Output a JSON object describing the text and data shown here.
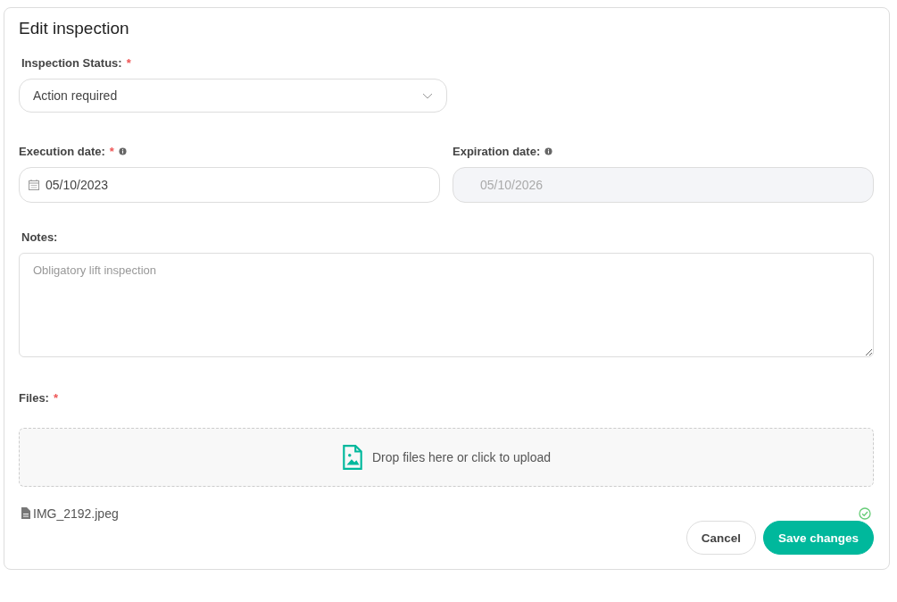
{
  "title": "Edit inspection",
  "status": {
    "label": "Inspection Status:",
    "required_mark": "*",
    "value": "Action required"
  },
  "dates": [
    {
      "label": "Execution date:",
      "required_mark": "*",
      "info": true,
      "value": "05/10/2023",
      "disabled": false,
      "calendar": true
    },
    {
      "label": "Expiration date:",
      "info": true,
      "value": "05/10/2026",
      "disabled": true,
      "calendar": false
    }
  ],
  "notes": {
    "label": "Notes:",
    "placeholder": "Obligatory lift inspection"
  },
  "files": {
    "label": "Files:",
    "required_mark": "*",
    "dropzone": "Drop files here or click to upload",
    "items": [
      {
        "name": "IMG_2192.jpeg",
        "uploaded": true
      }
    ]
  },
  "buttons": [
    {
      "label": "Cancel",
      "kind": "secondary"
    },
    {
      "label": "Save changes",
      "kind": "primary"
    }
  ]
}
